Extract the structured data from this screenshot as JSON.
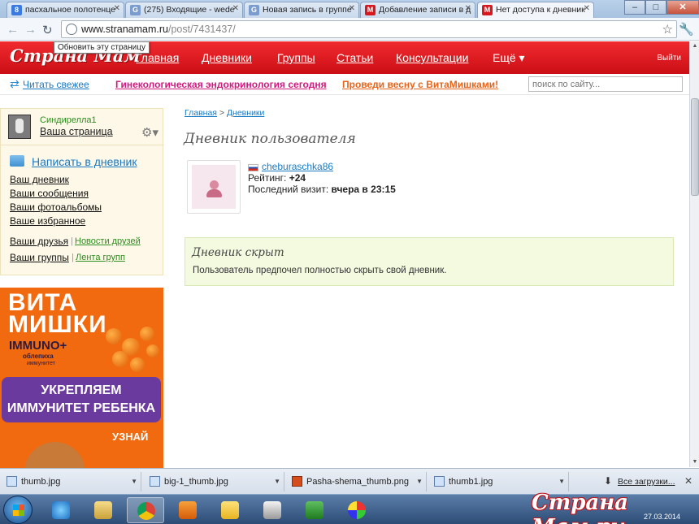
{
  "browser": {
    "tabs": [
      {
        "title": "пасхальное полотенце",
        "icon": "google-g-icon",
        "color": "#3b7be0",
        "glyph": "8"
      },
      {
        "title": "(275) Входящие - wede",
        "icon": "chrome-page-icon",
        "color": "#7a9ccf",
        "glyph": "G"
      },
      {
        "title": "Новая запись в группе",
        "icon": "chrome-page-icon",
        "color": "#7a9ccf",
        "glyph": "G"
      },
      {
        "title": "Добавление записи в д",
        "icon": "stranamam-m-icon",
        "color": "#d7191f",
        "glyph": "M"
      },
      {
        "title": "Нет доступа к дневник",
        "icon": "stranamam-m-icon",
        "color": "#d7191f",
        "glyph": "M"
      }
    ],
    "url_domain": "www.stranamam.ru",
    "url_path": "/post/7431437/",
    "tooltip": "Обновить эту страницу"
  },
  "site": {
    "logo": "Страна Мам",
    "nav": [
      "Главная",
      "Дневники",
      "Группы",
      "Статьи",
      "Консультации",
      "Ещё ▾"
    ],
    "logout": "Выйти",
    "read_fresh": "Читать свежее",
    "promo1": "Гинекологическая эндокринология сегодня",
    "promo2": "Проведи весну с ВитаМишками!",
    "search_placeholder": "поиск по сайту..."
  },
  "sidebar": {
    "username": "Синдирелла1",
    "my_page": "Ваша страница",
    "write": "Написать в дневник",
    "links": [
      "Ваш дневник",
      "Ваши сообщения",
      "Ваши фотоальбомы",
      "Ваше избранное"
    ],
    "friends": "Ваши друзья",
    "friends_news": "Новости друзей",
    "groups": "Ваши группы",
    "groups_feed": "Лента групп"
  },
  "ad": {
    "brand_line1": "ВИТА",
    "brand_line2": "МИШКИ",
    "immuno": "IMMUNO+",
    "sub1": "облепиха",
    "sub2": "иммунитет",
    "banner": "УКРЕПЛЯЕМ ИММУНИТЕТ РЕБЕНКА",
    "cta": "УЗНАЙ"
  },
  "main": {
    "crumb_home": "Главная",
    "crumb_sep": " > ",
    "crumb_diaries": "Дневники",
    "title": "Дневник пользователя",
    "user": "cheburaschka86",
    "rating_label": "Рейтинг: ",
    "rating": "+24",
    "last_visit_label": "Последний визит: ",
    "last_visit": "вчера в 23:15",
    "hidden_title": "Дневник скрыт",
    "hidden_text": "Пользователь предпочел полностью скрыть свой дневник."
  },
  "downloads": {
    "items": [
      "thumb.jpg",
      "big-1_thumb.jpg",
      "Pasha-shema_thumb.png",
      "thumb1.jpg"
    ],
    "all": "Все загрузки..."
  },
  "taskbar": {
    "watermark": "Страна Мам.ру",
    "date": "27.03.2014"
  }
}
